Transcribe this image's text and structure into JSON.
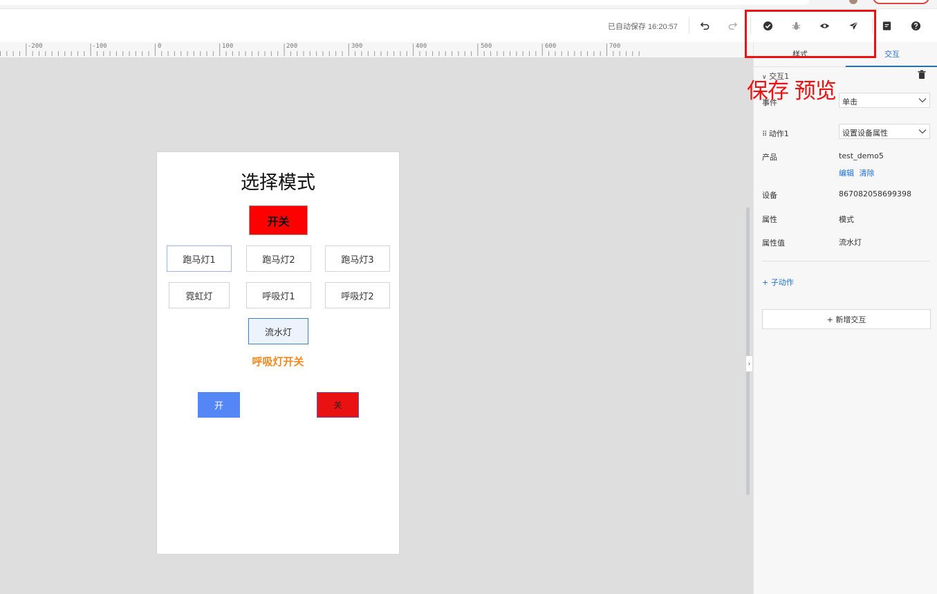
{
  "colors": {
    "accent": "#1d6fd8",
    "annotation": "#ee1111",
    "switch_red": "#ff0000",
    "on_blue": "#5487f5",
    "off_red": "#e91111",
    "label_orange": "#f2891e"
  },
  "toolbar": {
    "autosave": "已自动保存 16:20:57",
    "icons": {
      "undo": "undo-icon",
      "redo": "redo-icon",
      "save": "check-circle-icon",
      "debug": "bug-icon",
      "preview": "eye-icon",
      "publish": "send-icon",
      "doc": "document-icon",
      "help": "help-icon"
    }
  },
  "ruler": {
    "labels": [
      "-200",
      "-100",
      "0",
      "100",
      "200",
      "300",
      "400",
      "500",
      "600",
      "700"
    ]
  },
  "artboard": {
    "title": "选择模式",
    "switch_label": "开关",
    "mode_buttons": [
      "跑马灯1",
      "跑马灯2",
      "跑马灯3",
      "霓虹灯",
      "呼吸灯1",
      "呼吸灯2",
      "流水灯"
    ],
    "breath_label": "呼吸灯开关",
    "on_label": "开",
    "off_label": "关"
  },
  "panel": {
    "tabs": [
      "样式",
      "交互"
    ],
    "active_tab": "交互",
    "section_title": "交互1",
    "event_label": "事件",
    "event_value": "单击",
    "action_label": "动作1",
    "action_value": "设置设备属性",
    "product_label": "产品",
    "product_value": "test_demo5",
    "edit_link": "编辑",
    "clear_link": "清除",
    "device_label": "设备",
    "device_value": "867082058699398",
    "property_label": "属性",
    "property_value": "模式",
    "property_value_label": "属性值",
    "property_value_value": "流水灯",
    "add_sub_action": "+ 子动作",
    "add_interaction": "+ 新增交互"
  },
  "annotation": {
    "text": "保存 预览"
  }
}
